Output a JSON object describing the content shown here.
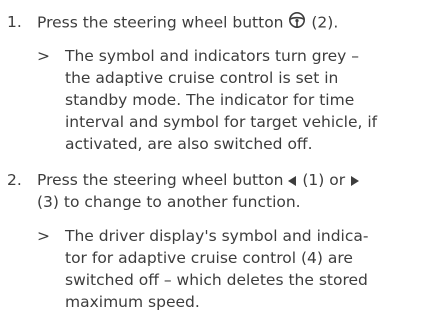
{
  "steps": [
    {
      "number": "1.",
      "instruction_before_icon": "Press the steering wheel button ",
      "icon": "steering-wheel-icon",
      "instruction_after_icon": " (2).",
      "result_marker": ">",
      "result_lines": [
        "The symbol and indicators turn grey –",
        "the adaptive cruise control is set in",
        "standby mode. The indicator for time",
        "interval and symbol for target vehicle, if",
        "activated, are also switched off."
      ]
    },
    {
      "number": "2.",
      "line1_before_left": "Press the steering wheel button ",
      "left_icon": "triangle-left-icon",
      "line1_mid": " (1) or ",
      "right_icon": "triangle-right-icon",
      "line2": "(3) to change to another function.",
      "result_marker": ">",
      "result_lines": [
        "The driver display's symbol and indica-",
        "tor for adaptive cruise control (4) are",
        "switched off – which deletes the stored",
        "maximum speed."
      ]
    }
  ]
}
